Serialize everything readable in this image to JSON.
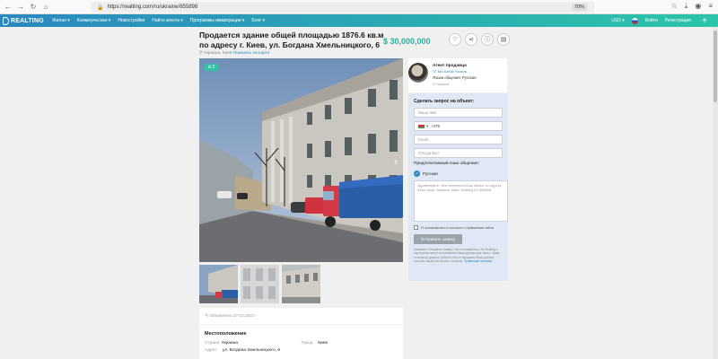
{
  "browser": {
    "url": "https://realting.com/ru/ukraine/855898",
    "zoom": "70%"
  },
  "header": {
    "logo_text": "REALTING",
    "menu": [
      "Жилая ▾",
      "Коммерческая ▾",
      "Новостройки",
      "Найти агента ▾",
      "Программы иммиграции ▾",
      "Блог ▾"
    ],
    "currency": "USD ▾",
    "login": "Войти",
    "register": "Регистрация",
    "add_label": "+"
  },
  "listing": {
    "title": "Продается здание общей площадью 1876.6 кв.м по адресу г. Киев, ул. Богдана Хмельницкого, 6",
    "price": "$ 30,000,000",
    "sub_location": "Украина, Киев",
    "show_on_map": "Показать на карте",
    "photo_count": "3",
    "published": "Обновлено 27.02.2023"
  },
  "location": {
    "heading": "Местоположение",
    "rows": [
      {
        "k1": "Страна",
        "v1": "Украина",
        "k2": "Город",
        "v2": "Киев"
      },
      {
        "k1": "Адрес",
        "v1": "ул. Богдана Хмельницкого, 6",
        "k2": "",
        "v2": ""
      }
    ]
  },
  "agent": {
    "label": "Агент продавца",
    "company": "ТЕ Вих-Белой-Россиль",
    "language": "Языки общения: Русская",
    "city": "Украина"
  },
  "form": {
    "title": "Сделать запрос на объект:",
    "name_placeholder": "Ваше имя",
    "phone_code": "+375",
    "email_placeholder": "Email",
    "city_placeholder": "Откуда Вы?",
    "lang_label": "Предпочитаемый язык общения:",
    "lang_option": "Русская",
    "message": "Здравствуйте. Мне интересен Ваш объект по адресу Киев, Киев, Украина, Киев. Realting ID=855898",
    "consent": "Я ознакомился и согласен с правилами сайта",
    "submit": "Отправить заявку",
    "disclaimer": "Нажимая «Отправить заявку», Вы соглашаетесь, что Realting с партнерами могут использовать Ваши данные для связи с Вами по вопросу данного объекта. Мы не передаем Ваши данные третьим лицам без Вашего согласия.",
    "privacy_link": "Правилами политики"
  },
  "colors": {
    "accent": "#2cc4a8",
    "brand_blue": "#2a88c0"
  }
}
